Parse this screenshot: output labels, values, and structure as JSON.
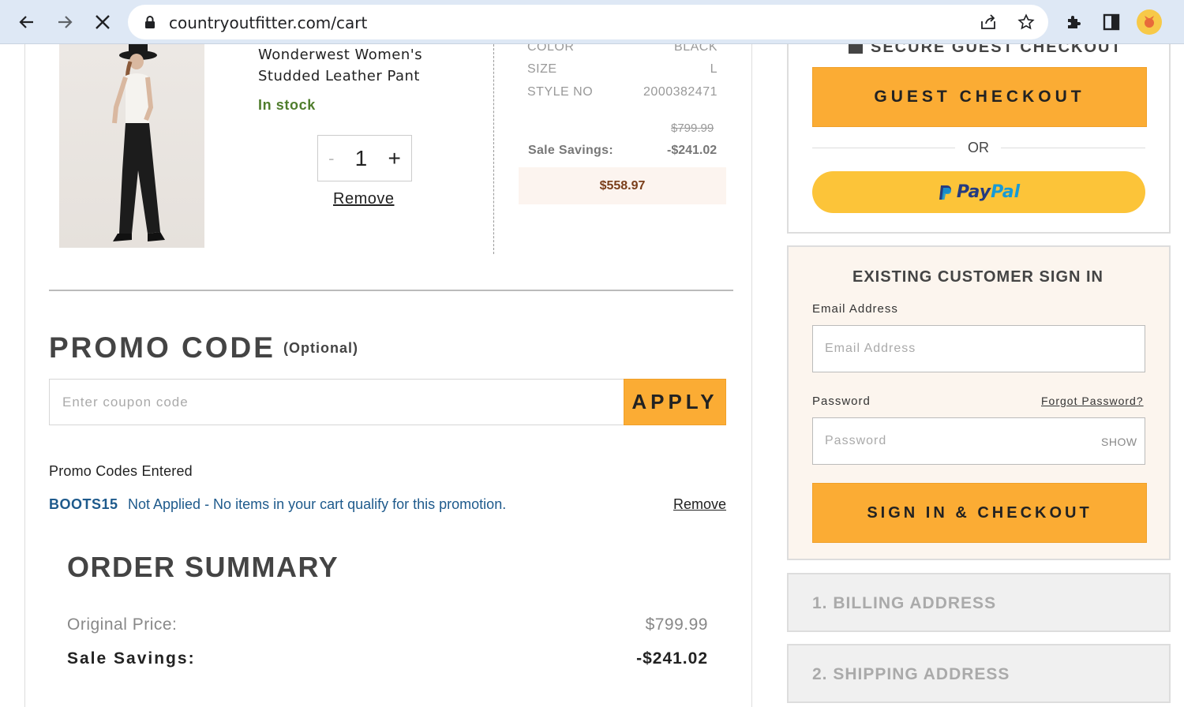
{
  "browser": {
    "url": "countryoutfitter.com/cart"
  },
  "product": {
    "name_line1": "Wonderwest Women's",
    "name_line2": "Studded Leather Pant",
    "stock": "In stock",
    "quantity": "1",
    "qty_minus": "-",
    "qty_plus": "+",
    "remove": "Remove",
    "attrs": [
      {
        "label": "COLOR",
        "value": "BLACK"
      },
      {
        "label": "SIZE",
        "value": "L"
      },
      {
        "label": "STYLE NO",
        "value": "2000382471"
      }
    ],
    "original_price": "$799.99",
    "sale_savings_label": "Sale Savings:",
    "sale_savings_value": "-$241.02",
    "total": "$558.97"
  },
  "promo": {
    "title": "PROMO CODE",
    "optional": "(Optional)",
    "placeholder": "Enter coupon code",
    "apply": "APPLY",
    "entered_heading": "Promo Codes Entered",
    "code": "BOOTS15",
    "message": "Not Applied - No items in your cart qualify for this promotion.",
    "remove": "Remove"
  },
  "order_summary": {
    "title": "ORDER SUMMARY",
    "original_label": "Original Price:",
    "original_value": "$799.99",
    "savings_label": "Sale Savings:",
    "savings_value": "-$241.02"
  },
  "checkout": {
    "secure_title": "SECURE GUEST CHECKOUT",
    "guest_button": "GUEST CHECKOUT",
    "or": "OR",
    "paypal_pay": "Pay",
    "paypal_pal": "Pal",
    "signin_title": "EXISTING CUSTOMER SIGN IN",
    "email_label": "Email Address",
    "email_placeholder": "Email Address",
    "password_label": "Password",
    "forgot": "Forgot Password?",
    "password_placeholder": "Password",
    "show": "SHOW",
    "signin_button": "SIGN IN & CHECKOUT",
    "step1": "1. BILLING ADDRESS",
    "step2": "2. SHIPPING ADDRESS"
  },
  "colors": {
    "accent_orange": "#fbac34",
    "paypal_yellow": "#fcc439",
    "promo_link_blue": "#1e5a8c",
    "in_stock_green": "#4f7d2c"
  }
}
